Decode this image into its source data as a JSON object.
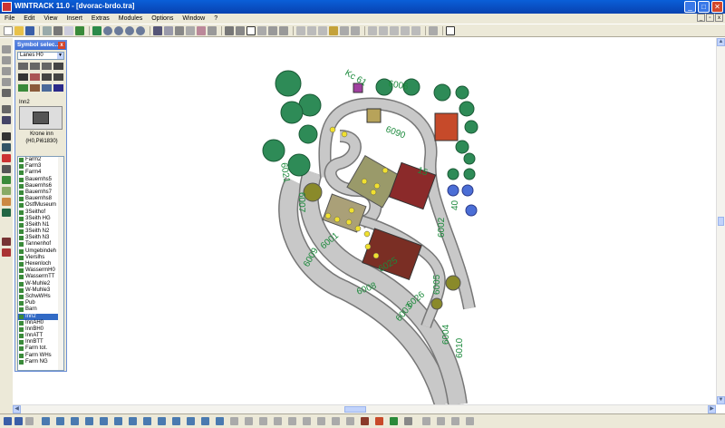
{
  "window": {
    "title": "WINTRACK 11.0 - [dvorac-brdo.tra]",
    "min": "_",
    "max": "□",
    "close": "✕"
  },
  "menu": [
    "File",
    "Edit",
    "View",
    "Insert",
    "Extras",
    "Modules",
    "Options",
    "Window",
    "?"
  ],
  "mdi": {
    "min": "_",
    "restore": "▫",
    "close": "x"
  },
  "symbol_panel": {
    "title": "Symbol selec...",
    "close": "x",
    "category": "Lanes H0",
    "selected_name": "Inn2",
    "caption_line1": "Krone inn",
    "caption_line2": "(H0,Pi61830)",
    "items": [
      "Farm2",
      "Farm3",
      "Farm4",
      "Bauernhs5",
      "Bauernhs6",
      "Bauernhs7",
      "Bauernhs8",
      "OstfMuseum",
      "3Seithof",
      "3Seith HG",
      "3Seith N1",
      "3Seith N2",
      "3Seith N3",
      "Tannenhof",
      "Umgebindeh",
      "Vierslhs",
      "Hexenloch",
      "WassermH0",
      "WassermTT",
      "W-Muhle2",
      "W-Muhle3",
      "SchwWHs",
      "Pub",
      "Barn",
      "Inn2",
      "InnAH0",
      "InnBH0",
      "InnATT",
      "InnBTT",
      "Farm tot.",
      "Farm WHs",
      "Farm NG"
    ],
    "selected_index": 24
  },
  "track_labels": [
    "6006",
    "6007",
    "6008",
    "6009",
    "6005",
    "6002",
    "6001",
    "6010",
    "6004",
    "6003",
    "Kc 61",
    "40",
    "6090",
    "6021",
    "6025",
    "6026",
    "15"
  ],
  "colors": {
    "titlebar": "#0842b0",
    "track": "#c8c8c8",
    "tree": "#2e8b57",
    "label": "#1c8a3c",
    "selection": "#316ac5"
  }
}
